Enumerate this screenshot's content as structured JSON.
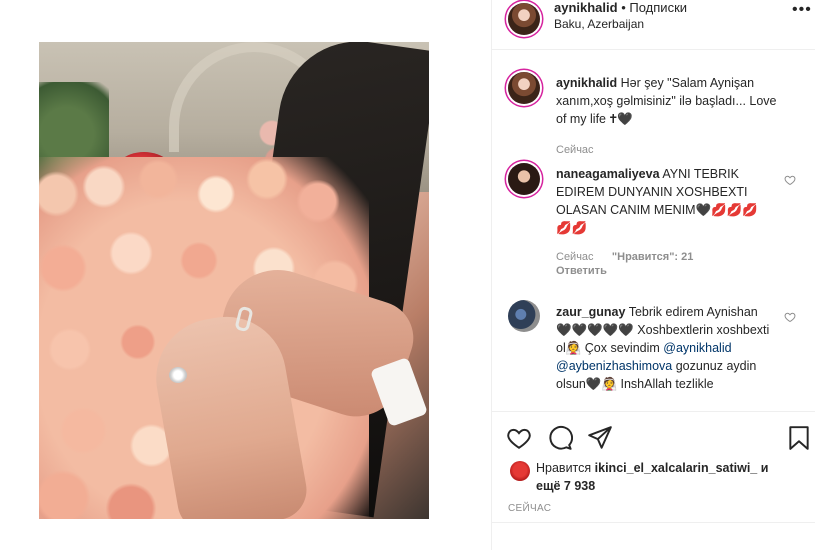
{
  "header": {
    "username": "aynikhalid",
    "separator": "•",
    "follow_label": "Подписки",
    "location": "Baku, Azerbaijan"
  },
  "caption": {
    "username": "aynikhalid",
    "text": "Hər şey \"Salam Aynişan xanım,xoş gəlmisiniz\" ilə başladı... Love of my life 🕇🖤",
    "time": "Сейчас"
  },
  "comments": [
    {
      "username": "naneagamaliyeva",
      "text": "AYNI TEBRIK EDIREM DUNYANIN XOSHBEXTI OLASAN CANIM MENIM🖤💋💋💋💋💋",
      "time": "Сейчас",
      "likes_label": "\"Нравится\": 21",
      "reply_label": "Ответить"
    },
    {
      "username": "zaur_gunay",
      "text_part1": "Tebrik edirem Aynishan🖤🖤🖤🖤🖤 Xoshbextlerin xoshbexti ol👰 Çox sevindim",
      "mention1": "@aynikhalid",
      "mention2": "@aybenizhashimova",
      "text_part2": "gozunuz aydin olsun🖤👰 InshAllah tezlikle"
    }
  ],
  "actions": {
    "likes_prefix": "Нравится",
    "likes_user": "ikinci_el_xalcalarin_satiwi_",
    "likes_suffix": "и ещё 7 938",
    "time_label": "СЕЙЧАС"
  },
  "icons": {
    "more": "more-icon",
    "heart": "heart-icon",
    "comment": "comment-icon",
    "share": "share-icon",
    "save": "bookmark-icon"
  },
  "colors": {
    "story_ring": "#d6249f",
    "muted": "#8e8e8e",
    "link": "#003569"
  }
}
